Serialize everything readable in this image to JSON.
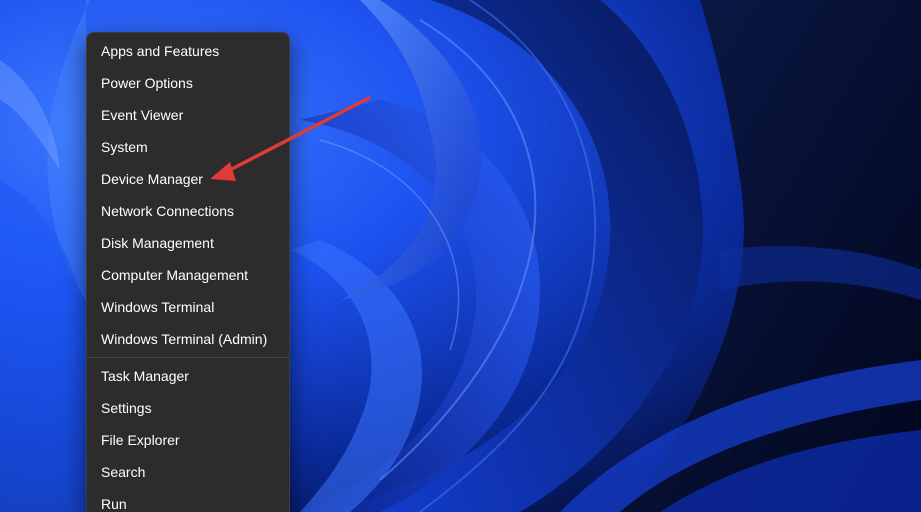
{
  "menu": {
    "group_one": [
      {
        "id": "apps-and-features",
        "label": "Apps and Features"
      },
      {
        "id": "power-options",
        "label": "Power Options"
      },
      {
        "id": "event-viewer",
        "label": "Event Viewer"
      },
      {
        "id": "system",
        "label": "System"
      },
      {
        "id": "device-manager",
        "label": "Device Manager"
      },
      {
        "id": "network-connections",
        "label": "Network Connections"
      },
      {
        "id": "disk-management",
        "label": "Disk Management"
      },
      {
        "id": "computer-management",
        "label": "Computer Management"
      },
      {
        "id": "windows-terminal",
        "label": "Windows Terminal"
      },
      {
        "id": "windows-terminal-admin",
        "label": "Windows Terminal (Admin)"
      }
    ],
    "group_two": [
      {
        "id": "task-manager",
        "label": "Task Manager"
      },
      {
        "id": "settings",
        "label": "Settings"
      },
      {
        "id": "file-explorer",
        "label": "File Explorer"
      },
      {
        "id": "search",
        "label": "Search"
      },
      {
        "id": "run",
        "label": "Run"
      }
    ]
  },
  "annotation": {
    "icon": "red-arrow-icon",
    "color": "#e03a3a",
    "points_to": "device-manager"
  },
  "colors": {
    "menu_background": "#2c2c2c",
    "menu_text": "#ffffff",
    "wallpaper_blue": "#1e5cff"
  }
}
